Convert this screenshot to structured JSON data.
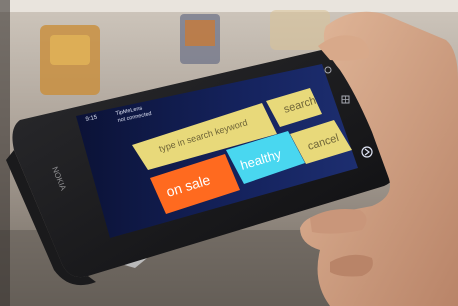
{
  "status": {
    "time": "9:15",
    "app_name": "TipMeLens",
    "connection": "not connected"
  },
  "tiles": {
    "search_input_placeholder": "type in search keyword",
    "search_label": "search",
    "cancel_label": "cancel",
    "on_sale_label": "on sale",
    "healthy_label": "healthy"
  },
  "device": {
    "brand": "NOKIA"
  },
  "colors": {
    "tile_yellow": "#e8d97a",
    "tile_orange": "#ff6a1f",
    "tile_cyan": "#49d7f0",
    "screen_bg": "#101c4a"
  }
}
